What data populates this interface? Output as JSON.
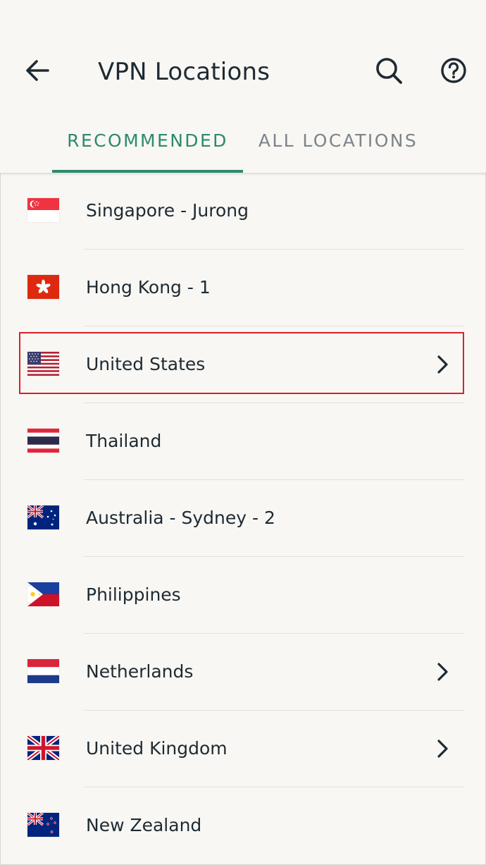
{
  "header": {
    "title": "VPN Locations",
    "back_icon": "arrow-left-icon",
    "search_icon": "search-icon",
    "help_icon": "help-circle-icon"
  },
  "tabs": [
    {
      "label": "RECOMMENDED",
      "active": true
    },
    {
      "label": "ALL LOCATIONS",
      "active": false
    }
  ],
  "colors": {
    "accent": "#2d8a6d",
    "inactive_tab": "#7d8489",
    "background": "#f8f7f3",
    "highlight": "#d9202b"
  },
  "locations": [
    {
      "name": "Singapore - Jurong",
      "flag": "singapore-flag-icon",
      "has_chevron": false
    },
    {
      "name": "Hong Kong - 1",
      "flag": "hong-kong-flag-icon",
      "has_chevron": false
    },
    {
      "name": "United States",
      "flag": "united-states-flag-icon",
      "has_chevron": true,
      "highlighted": true
    },
    {
      "name": "Thailand",
      "flag": "thailand-flag-icon",
      "has_chevron": false
    },
    {
      "name": "Australia - Sydney - 2",
      "flag": "australia-flag-icon",
      "has_chevron": false
    },
    {
      "name": "Philippines",
      "flag": "philippines-flag-icon",
      "has_chevron": false
    },
    {
      "name": "Netherlands",
      "flag": "netherlands-flag-icon",
      "has_chevron": true
    },
    {
      "name": "United Kingdom",
      "flag": "united-kingdom-flag-icon",
      "has_chevron": true
    },
    {
      "name": "New Zealand",
      "flag": "new-zealand-flag-icon",
      "has_chevron": false
    }
  ]
}
